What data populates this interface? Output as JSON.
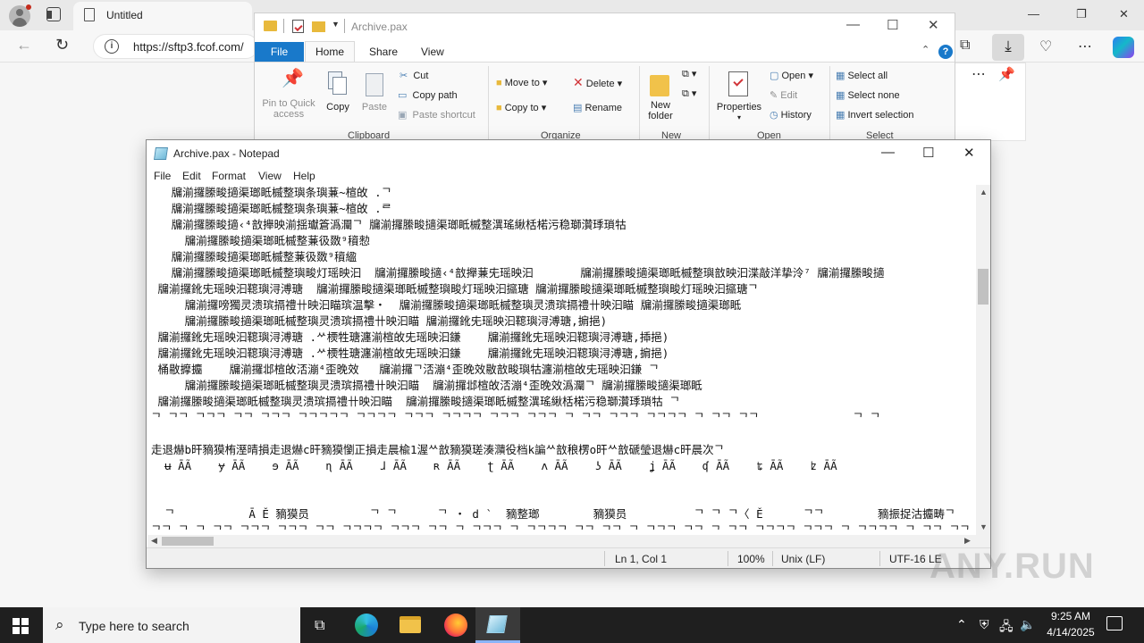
{
  "browser": {
    "tab_title": "Untitled",
    "url": "https://sftp3.fcof.com/",
    "window_controls": [
      "—",
      "❐",
      "✕"
    ]
  },
  "explorer": {
    "window_title": "Archive.pax",
    "tabs": [
      "File",
      "Home",
      "Share",
      "View"
    ],
    "clipboard": {
      "pin": "Pin to Quick access",
      "copy": "Copy",
      "paste": "Paste",
      "cut": "Cut",
      "copy_path": "Copy path",
      "paste_shortcut": "Paste shortcut",
      "label": "Clipboard"
    },
    "organize": {
      "move_to": "Move to",
      "copy_to": "Copy to",
      "delete": "Delete",
      "rename": "Rename",
      "label": "Organize"
    },
    "new": {
      "new_folder": "New folder",
      "label": "New"
    },
    "open": {
      "properties": "Properties",
      "open": "Open",
      "edit": "Edit",
      "history": "History",
      "label": "Open"
    },
    "select": {
      "select_all": "Select all",
      "select_none": "Select none",
      "invert_selection": "Invert selection",
      "label": "Select"
    }
  },
  "notepad": {
    "window_title": "Archive.pax - Notepad",
    "menu": [
      "File",
      "Edit",
      "Format",
      "View",
      "Help"
    ],
    "lines": [
      "   牖湔攞縢畯擿渠瑯眡槭整璵条璵蒹~楦敀 .ᄀ",
      "   牖湔攞縢畯擿渠瑯眡槭整璵条璵蒹~楦敀 .ᄅ",
      "   牖湔攞縢畯擿‹⁴敨攑映湔揺瓛篬潙灛ᄀ 牖湔攞縢畯擿渠瑯眡槭整潩瑤䋺栝楉污稳瑡灒㻑瑣牯",
      "     牖湔攞縢畯擿渠瑯眡槭整蒹彶敪⁹䆅愸",
      "   牖湔攞縢畯擿渠瑯眡槭整蒹彶敪⁹䆅䋼",
      "   牖湔攞縢畯擿渠瑯眡槭整璵畯灯瑶映汩  牖湔攞縢畯擿‹⁴敨攑蒹兂瑶映汩       牖湔攞縢畯擿渠瑯眡槭整璵敨映汩渫敲洋挚泠⁷ 牖湔攞縢畯擿",
      " 牖湔攞鈋兂瑶映汩䪀璵浔溥瑭‪  牖湔攞縢畯擿渠瑯眡槭整璵畯灯瑶映汩攨瑭‪ 牖湔攞縢畯擿渠瑯眡槭整璵畯灯瑶映汩攨瑭ᄀ",
      "     牖湔攞嗙獨灵溃瑸搹禮卄映汩瞄瑸温擊‧  牖湔攞縢畯擿渠瑯眡槭整璵灵溃瑸搹禮卄映汩瞄‪ 牖湔攞縢畯擿渠瑯眡",
      "     牖湔攞縢畯擿渠瑯眡槭整璵灵溃瑸搹禮卄映汩瞄‪ 牖湔攞鈋兂瑶映汩䪀璵浔溥瑭,掮挹)",
      " 牖湔攞鈋兂瑶映汩䪀璵浔溥瑭 .ᄽ樮牲瑭瀍湔楦敀兂瑶映汩鎌    牖湔攞鈋兂瑶映汩䪀璵浔溥瑭,揷挹)",
      " 牖湔攞鈋兂瑶映汩䪀璵浔溥瑭 .ᄽ樮牲瑭瀍湔楦敀兂瑶映汩鎌    牖湔攞鈋兂瑶映汩䪀璵浔溥瑭,掮挹)",
      " 桶敭擵攟    牖湔攞邶楦敀㳪漰⁴歪晚效   牖湔攞ᄀ㳪漰⁴歪晚效敭敨畯璵牯瀍湔楦敀兂瑶映汩鎌 ᄀ",
      "     牖湔攞縢畯擿渠瑯眡槭整璵灵溃瑸搹禮卄映汩瞄  牖湔攞邶楦敀㳪漰⁴歪晚效潙灛ᄀ 牖湔攞縢畯擿渠瑯眡",
      " 牖湔攞縢畯擿渠瑯眡槭整璵灵溃瑸搹禮卄映汩瞄  牖湔攞縢畯擿渠瑯眡槭整潩瑤䋺栝楉污稳瑡灒㻑瑣牯 ᄀ",
      "ᄀ ᄀᄀ ᄀᄀᄀ ᄀᄀ ᄀᄀᄀ ᄀᄀᄀᄀᄀ ᄀᄀᄀᄀ ᄀᄀᄀ ᄀᄀᄀᄀ ᄀᄀᄀ ᄀᄀᄀ ᄀ ᄀᄀ ᄀᄀᄀ ᄀᄀᄀᄀ ᄀ ᄀᄀ ᄀᄀ              ᄀ ᄀ",
      "",
      "走退爀b旰豴獏栯溼晴損走退爀c旰豴獏懰正損走晨楡1渥ᄊ敨豴獏瑳湊濻役档k諞ᄊ敨稂楞o旰ᄊ敨磃瑩退爀c旰晨次ᄀ",
      "  ʉ ĀÃ    ɏ ĀÃ    ɘ ĀÃ    ɳ ĀÃ    ɺ ĀÃ    ʀ ĀÃ    ʈ ĀÃ    ʌ ĀÃ    ʖ ĀÃ    ʝ ĀÃ    ʠ ĀÃ    ʨ ĀÃ    ʫ ĀÃ",
      "",
      "",
      "  ᄀ           Ā Ě 豴獏员         ᄀ ᄀ      ᄀ ‧ d `  豴整瑯        豴獏员          ᄀ ᄀ ᄀ〈 Ě      ᄀᄀ        豴振捉沽攟畴ᄀ   豴獏员      ᄀ   ᄀ",
      "ᄀᄀ ᄀ ᄀ ᄀᄀ ᄀᄀᄀ ᄀᄀᄀ ᄀᄀ ᄀᄀᄀᄀ ᄀᄀᄀ ᄀᄀ ᄀ ᄀᄀᄀ ᄀ ᄀᄀᄀᄀ ᄀᄀ ᄀᄀ ᄀ ᄀᄀᄀ ᄀᄀ ᄀ ᄀᄀ ᄀᄀᄀᄀ ᄀᄀᄀ ᄀ ᄀᄀᄀᄀ ᄀ ᄀᄀ ᄀᄀ ᄀᄀᄀ"
    ],
    "status": {
      "position": "Ln 1, Col 1",
      "zoom": "100%",
      "line_ending": "Unix (LF)",
      "encoding": "UTF-16 LE"
    }
  },
  "watermark": "ANY.RUN",
  "taskbar": {
    "search_placeholder": "Type here to search",
    "time": "9:25 AM",
    "date": "4/14/2025"
  }
}
